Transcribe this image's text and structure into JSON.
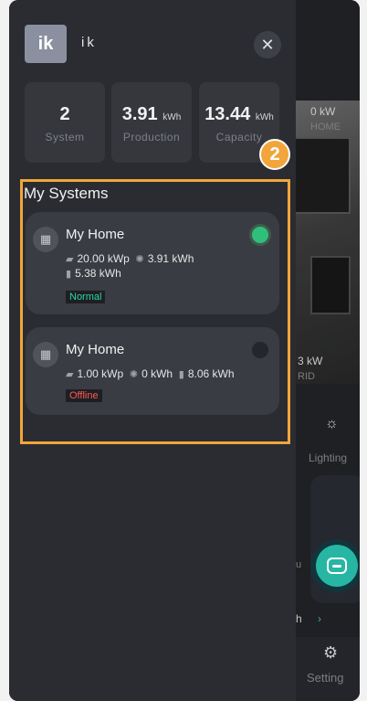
{
  "user": {
    "initials": "ik",
    "name": "ik"
  },
  "stats": [
    {
      "value": "2",
      "unit": "",
      "label": "System"
    },
    {
      "value": "3.91",
      "unit": "kWh",
      "label": "Production"
    },
    {
      "value": "13.44",
      "unit": "kWh",
      "label": "Capacity"
    }
  ],
  "annotation_marker": "2",
  "section_title": "My Systems",
  "systems": [
    {
      "name": "My Home",
      "capacity": "20.00 kWp",
      "production": "3.91 kWh",
      "storage": "5.38 kWh",
      "status": "Normal",
      "online": true
    },
    {
      "name": "My Home",
      "capacity": "1.00 kWp",
      "production": "0 kWh",
      "storage": "8.06 kWh",
      "status": "Offline",
      "online": false
    }
  ],
  "background": {
    "home_power": "0 kW",
    "home_label": "HOME",
    "grid_power": "3 kW",
    "grid_label": "RID",
    "lighting_label": "Lighting",
    "setting_label": "Setting",
    "partial_text_1": "u",
    "partial_text_2": "h"
  },
  "colors": {
    "accent": "#f2a53a",
    "online": "#2fbf7b",
    "offline_text": "#ff5a52",
    "normal_text": "#2fd3a6"
  }
}
